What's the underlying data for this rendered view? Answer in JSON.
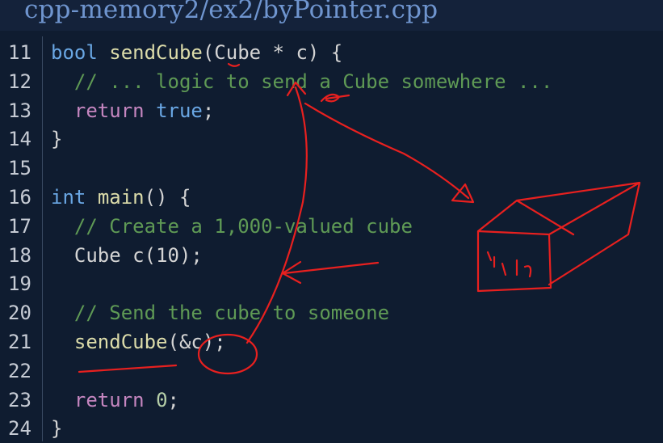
{
  "title": "cpp-memory2/ex2/byPointer.cpp",
  "annotation_text": "P|h",
  "lines": [
    {
      "n": "11",
      "tokens": [
        {
          "t": "bool",
          "c": "kw"
        },
        {
          "t": " ",
          "c": "pl"
        },
        {
          "t": "sendCube",
          "c": "fn"
        },
        {
          "t": "(Cube * c) {",
          "c": "pl"
        }
      ]
    },
    {
      "n": "12",
      "tokens": [
        {
          "t": "  // ... logic to send a Cube somewhere ...",
          "c": "cm"
        }
      ]
    },
    {
      "n": "13",
      "tokens": [
        {
          "t": "  ",
          "c": "pl"
        },
        {
          "t": "return",
          "c": "kw2"
        },
        {
          "t": " ",
          "c": "pl"
        },
        {
          "t": "true",
          "c": "kw"
        },
        {
          "t": ";",
          "c": "pl"
        }
      ]
    },
    {
      "n": "14",
      "tokens": [
        {
          "t": "}",
          "c": "pl"
        }
      ]
    },
    {
      "n": "15",
      "tokens": []
    },
    {
      "n": "16",
      "tokens": [
        {
          "t": "int",
          "c": "kw"
        },
        {
          "t": " ",
          "c": "pl"
        },
        {
          "t": "main",
          "c": "fn"
        },
        {
          "t": "() {",
          "c": "pl"
        }
      ]
    },
    {
      "n": "17",
      "tokens": [
        {
          "t": "  // Create a 1,000-valued cube",
          "c": "cm"
        }
      ]
    },
    {
      "n": "18",
      "tokens": [
        {
          "t": "  Cube c(10);",
          "c": "pl"
        }
      ]
    },
    {
      "n": "19",
      "tokens": []
    },
    {
      "n": "20",
      "tokens": [
        {
          "t": "  // Send the cube to someone",
          "c": "cm"
        }
      ]
    },
    {
      "n": "21",
      "tokens": [
        {
          "t": "  ",
          "c": "pl"
        },
        {
          "t": "sendCube",
          "c": "fn"
        },
        {
          "t": "(&c);",
          "c": "pl"
        }
      ]
    },
    {
      "n": "22",
      "tokens": []
    },
    {
      "n": "23",
      "tokens": [
        {
          "t": "  ",
          "c": "pl"
        },
        {
          "t": "return",
          "c": "kw2"
        },
        {
          "t": " ",
          "c": "pl"
        },
        {
          "t": "0",
          "c": "num"
        },
        {
          "t": ";",
          "c": "pl"
        }
      ]
    },
    {
      "n": "24",
      "tokens": [
        {
          "t": "}",
          "c": "pl"
        }
      ]
    }
  ]
}
